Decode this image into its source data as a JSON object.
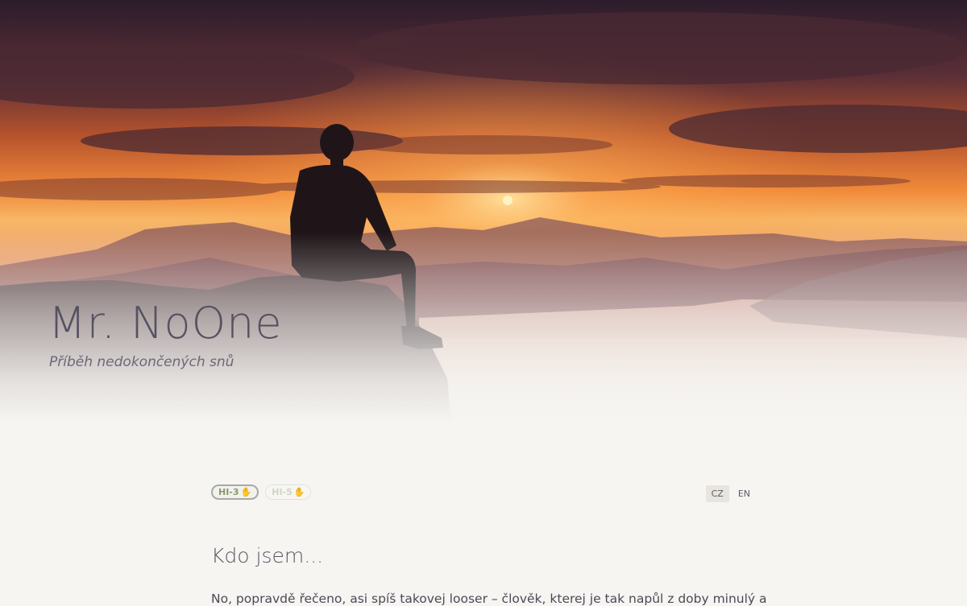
{
  "header": {
    "title": "Mr. NoOne",
    "subtitle": "Příběh nedokončených snů"
  },
  "badges": [
    {
      "label": "HI-3",
      "icon": "clapping-hands-icon",
      "active": true
    },
    {
      "label": "HI-5",
      "icon": "clapping-hands-icon",
      "active": false
    }
  ],
  "language": {
    "options": [
      "CZ",
      "EN"
    ],
    "selected": "CZ"
  },
  "about": {
    "heading": "Kdo jsem...",
    "text": "No, popravdě řečeno, asi spíš takovej looser – člověk, kterej je tak napůl z doby minulý a"
  },
  "colors": {
    "background": "#f6f5f2",
    "title": "#565262",
    "badge_text": "#8a9a6f",
    "sunset_orange": "#f08a3a"
  }
}
